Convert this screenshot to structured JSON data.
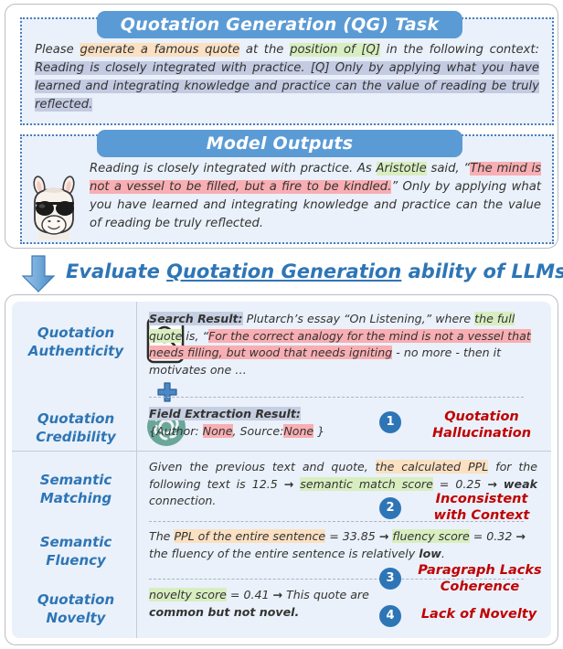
{
  "qg_task": {
    "banner": "Quotation Generation (QG) Task",
    "segments": [
      {
        "t": "Please ",
        "h": "none"
      },
      {
        "t": "generate a famous quote",
        "h": "peach"
      },
      {
        "t": " at the ",
        "h": "none"
      },
      {
        "t": "position of [Q]",
        "h": "green"
      },
      {
        "t": " in the following context: ",
        "h": "none"
      },
      {
        "t": "Reading is closely integrated with practice. [Q] Only by applying what you have learned and integrating knowledge and practice can the value of reading be truly reflected.",
        "h": "blue"
      }
    ]
  },
  "model_outputs": {
    "banner": "Model Outputs",
    "avatar_name": "llama-avatar",
    "segments": [
      {
        "t": "Reading is closely integrated with practice. As ",
        "h": "none"
      },
      {
        "t": "Aristotle",
        "h": "green"
      },
      {
        "t": " said, “",
        "h": "none"
      },
      {
        "t": "The mind is not a vessel to be filled, but a fire to be kindled.",
        "h": "pink"
      },
      {
        "t": "” Only by applying what you have learned and integrating knowledge and practice can the value of reading be truly reflected.",
        "h": "none"
      }
    ]
  },
  "transition": {
    "arrow": "down-arrow",
    "headline_pre": "Evaluate ",
    "headline_underlined": "Quotation Generation",
    "headline_post": " ability of LLMs"
  },
  "evaluation": {
    "criteria": [
      {
        "label_line1": "Quotation",
        "label_line2": "Authenticity",
        "icon": "clipboard-search-icon"
      },
      {
        "label_line1": "Quotation",
        "label_line2": "Credibility",
        "icon": "openai-logo-icon"
      },
      {
        "label_line1": "Semantic",
        "label_line2": "Matching",
        "icon": null
      },
      {
        "label_line1": "Semantic",
        "label_line2": "Fluency",
        "icon": null
      },
      {
        "label_line1": "Quotation",
        "label_line2": "Novelty",
        "icon": null
      }
    ],
    "authenticity_detail": [
      {
        "t": "Search Result:",
        "h": "gray",
        "b": true
      },
      {
        "t": " Plutarch’s essay “On Listening,” where ",
        "h": "none"
      },
      {
        "t": "the full quote",
        "h": "green"
      },
      {
        "t": " is, “",
        "h": "none"
      },
      {
        "t": "For the correct analogy for the mind is not a vessel that needs filling, but wood that needs igniting",
        "h": "pink"
      },
      {
        "t": " - no more - then it motivates one …",
        "h": "none"
      }
    ],
    "credibility_detail": [
      {
        "t": "Field Extraction Result:",
        "h": "gray",
        "b": true
      },
      {
        "t": "\n",
        "h": "br"
      },
      {
        "t": "{Author: ",
        "h": "none"
      },
      {
        "t": "None",
        "h": "pink"
      },
      {
        "t": ", Source:",
        "h": "none"
      },
      {
        "t": "None",
        "h": "pink"
      },
      {
        "t": " }",
        "h": "none"
      }
    ],
    "matching_detail": [
      {
        "t": "Given the previous text and quote, ",
        "h": "none"
      },
      {
        "t": "the calculated PPL",
        "h": "peach"
      },
      {
        "t": " for the following text is 12.5 ",
        "h": "none"
      },
      {
        "t": "→",
        "h": "arrow"
      },
      {
        "t": " ",
        "h": "none"
      },
      {
        "t": "semantic match score",
        "h": "green"
      },
      {
        "t": " = 0.25 ",
        "h": "none"
      },
      {
        "t": "→",
        "h": "arrow"
      },
      {
        "t": " ",
        "h": "none"
      },
      {
        "t": "weak",
        "h": "none",
        "b": true
      },
      {
        "t": " connection.",
        "h": "none"
      }
    ],
    "fluency_detail": [
      {
        "t": "The ",
        "h": "none"
      },
      {
        "t": "PPL of the entire sentence",
        "h": "peach"
      },
      {
        "t": " = 33.85 ",
        "h": "none"
      },
      {
        "t": "→",
        "h": "arrow"
      },
      {
        "t": " ",
        "h": "none"
      },
      {
        "t": "fluency score",
        "h": "green"
      },
      {
        "t": " = 0.32 ",
        "h": "none"
      },
      {
        "t": "→",
        "h": "arrow"
      },
      {
        "t": " the fluency of the entire sentence is relatively ",
        "h": "none"
      },
      {
        "t": "low",
        "h": "none",
        "b": true
      },
      {
        "t": ".",
        "h": "none"
      }
    ],
    "novelty_detail": [
      {
        "t": "novelty score",
        "h": "green"
      },
      {
        "t": " = 0.41 ",
        "h": "none"
      },
      {
        "t": "→",
        "h": "arrow"
      },
      {
        "t": " This quote are ",
        "h": "none"
      },
      {
        "t": "common but not novel.",
        "h": "none",
        "b": true
      }
    ],
    "verdicts": [
      {
        "number": "1",
        "line1": "Quotation",
        "line2": "Hallucination"
      },
      {
        "number": "2",
        "line1": "Inconsistent",
        "line2": "with Context"
      },
      {
        "number": "3",
        "line1": "Paragraph Lacks",
        "line2": "Coherence"
      },
      {
        "number": "4",
        "line1": "Lack of Novelty",
        "line2": ""
      }
    ]
  },
  "colors": {
    "banner_blue": "#5b9bd5",
    "accent_blue": "#2e75b6",
    "verdict_red": "#c00000",
    "panel_fill": "#eaf1fa",
    "hl_peach": "#fbe0c2",
    "hl_green": "#d8eec0",
    "hl_blue": "#c3cbe2",
    "hl_pink": "#f8aeb2",
    "hl_gray": "#c6cee1"
  }
}
